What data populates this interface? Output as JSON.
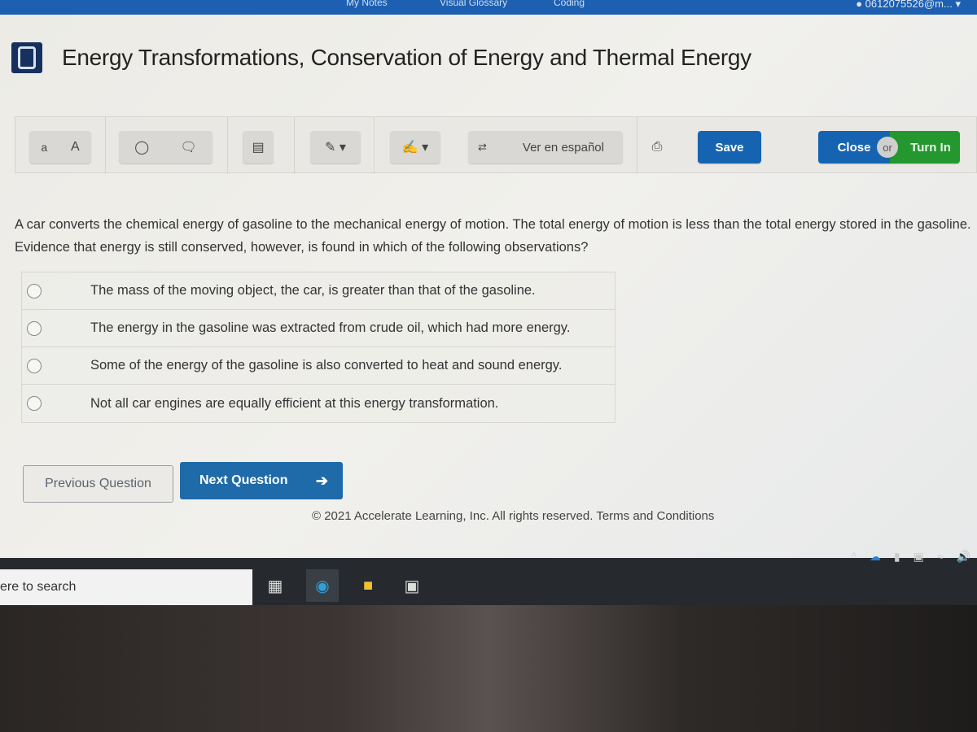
{
  "top_nav": {
    "items": [
      "My Notes",
      "Visual Glossary",
      "Coding"
    ],
    "user": "0612075526@m..."
  },
  "header": {
    "title": "Energy Transformations, Conservation of Energy and Thermal Energy"
  },
  "toolbar": {
    "font_small": "a",
    "font_large": "A",
    "spanish_label": "Ver en español",
    "save_label": "Save",
    "close_label": "Close",
    "or_label": "or",
    "turn_in_label": "Turn In"
  },
  "question": {
    "text": "A car converts the chemical energy of gasoline to the mechanical energy of motion. The total energy of motion is less than the total energy stored in the gasoline. Evidence that energy is still conserved, however, is found in which of the following observations?",
    "choices": [
      "The mass of the moving object, the car, is greater than that of the gasoline.",
      "The energy in the gasoline was extracted from crude oil, which had more energy.",
      "Some of the energy of the gasoline is also converted to heat and sound energy.",
      "Not all car engines are equally efficient at this energy transformation."
    ]
  },
  "navigation": {
    "previous_label": "Previous Question",
    "next_label": "Next Question",
    "next_arrow": "➔"
  },
  "footer": {
    "copyright": "© 2021 Accelerate Learning, Inc. All rights reserved.",
    "terms_link": "Terms and Conditions"
  },
  "taskbar": {
    "search_text": "ere to search"
  },
  "colors": {
    "nav_blue": "#1d5fb0",
    "save_blue": "#1664b1",
    "turn_in_green": "#24982f",
    "next_blue": "#1f6aa8"
  }
}
